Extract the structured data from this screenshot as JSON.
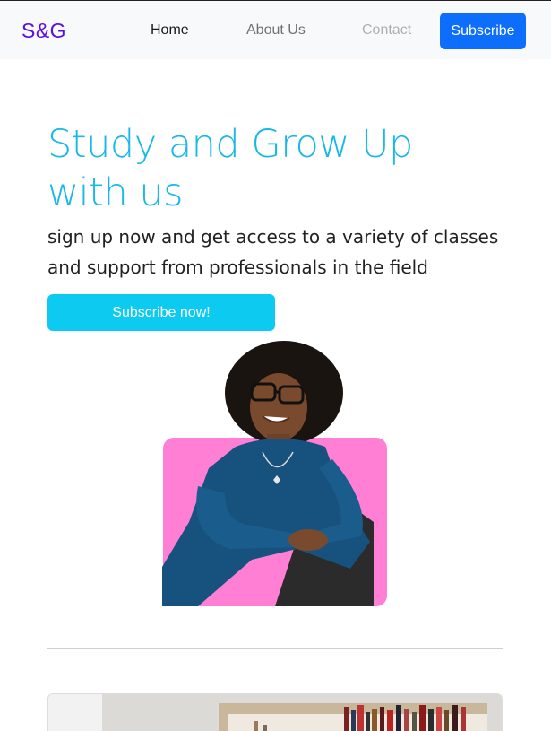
{
  "navbar": {
    "brand": "S&G",
    "links": [
      {
        "label": "Home"
      },
      {
        "label": "About Us"
      },
      {
        "label": "Contact"
      }
    ],
    "subscribe_label": "Subscribe"
  },
  "hero": {
    "title": "Study and Grow Up with us",
    "subtitle": "sign up now and get access to a variety of classes and support from professionals in the field",
    "cta_label": "Subscribe now!"
  },
  "colors": {
    "brand": "#5b0fe0",
    "primary": "#0d6efd",
    "info": "#0dcaf0",
    "title": "#1ab8e6",
    "photo_backdrop": "#ff7fd4"
  }
}
